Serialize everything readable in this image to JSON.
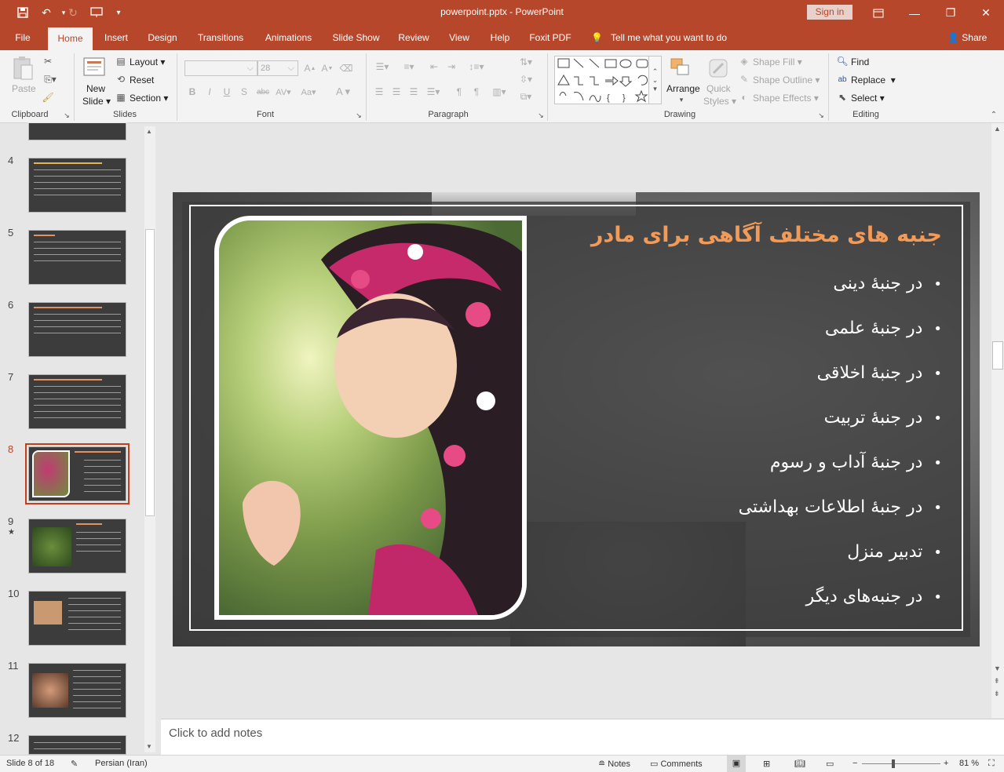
{
  "window": {
    "doc_title": "powerpoint.pptx  -  PowerPoint",
    "signin": "Sign in"
  },
  "tabs": [
    "File",
    "Home",
    "Insert",
    "Design",
    "Transitions",
    "Animations",
    "Slide Show",
    "Review",
    "View",
    "Help",
    "Foxit PDF"
  ],
  "active_tab": "Home",
  "tell_me": "Tell me what you want to do",
  "share": "Share",
  "ribbon": {
    "clipboard": {
      "paste": "Paste",
      "label": "Clipboard"
    },
    "slides": {
      "new_slide_1": "New",
      "new_slide_2": "Slide",
      "layout": "Layout",
      "reset": "Reset",
      "section": "Section",
      "label": "Slides"
    },
    "font": {
      "font_size": "28",
      "label": "Font"
    },
    "paragraph": {
      "label": "Paragraph"
    },
    "drawing": {
      "arrange": "Arrange",
      "quick_styles_1": "Quick",
      "quick_styles_2": "Styles",
      "shape_fill": "Shape Fill",
      "shape_outline": "Shape Outline",
      "shape_effects": "Shape Effects",
      "label": "Drawing"
    },
    "editing": {
      "find": "Find",
      "replace": "Replace",
      "select": "Select",
      "label": "Editing"
    }
  },
  "thumbnails": [
    {
      "num": "4",
      "star": ""
    },
    {
      "num": "5",
      "star": ""
    },
    {
      "num": "6",
      "star": ""
    },
    {
      "num": "7",
      "star": ""
    },
    {
      "num": "8",
      "star": ""
    },
    {
      "num": "9",
      "star": "★"
    },
    {
      "num": "10",
      "star": ""
    },
    {
      "num": "11",
      "star": ""
    },
    {
      "num": "12",
      "star": ""
    }
  ],
  "selected_slide": "8",
  "slide": {
    "title": "جنبه های مختلف آگاهی برای مادر",
    "bullets": [
      "در جنبۀ دینی",
      "در جنبۀ علمی",
      "در جنبۀ اخلاقی",
      "در جنبۀ تربیت",
      "در جنبۀ آداب و رسوم",
      "در جنبۀ اطلاعات بهداشتی",
      "تدبیر منزل",
      "در جنبه‌های دیگر"
    ]
  },
  "notes_placeholder": "Click to add notes",
  "status": {
    "slide_of": "Slide 8 of 18",
    "language": "Persian (Iran)",
    "notes": "Notes",
    "comments": "Comments",
    "zoom": "81 %"
  },
  "colors": {
    "accent": "#b7472a",
    "title_orange": "#f29a57"
  }
}
